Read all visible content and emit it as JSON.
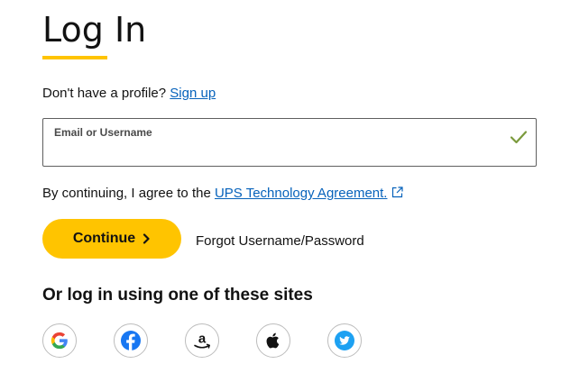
{
  "page": {
    "title": "Log In"
  },
  "signup": {
    "prompt": "Don't have a profile?",
    "link_label": "Sign up"
  },
  "email_field": {
    "label": "Email or Username",
    "value": "",
    "status_icon": "check-icon"
  },
  "agreement": {
    "prefix": "By continuing, I agree to the",
    "link_label": "UPS Technology Agreement.",
    "link_icon": "external-link-icon"
  },
  "actions": {
    "continue_label": "Continue",
    "continue_icon": "chevron-right-icon",
    "forgot_label": "Forgot Username/Password"
  },
  "social": {
    "heading": "Or log in using one of these sites",
    "providers": [
      {
        "name": "Google",
        "icon": "google-icon"
      },
      {
        "name": "Facebook",
        "icon": "facebook-icon"
      },
      {
        "name": "Amazon",
        "icon": "amazon-icon"
      },
      {
        "name": "Apple",
        "icon": "apple-icon"
      },
      {
        "name": "Twitter",
        "icon": "twitter-icon"
      }
    ]
  },
  "colors": {
    "accent": "#ffc400",
    "link": "#0662bb",
    "check": "#7b9a3c",
    "text": "#121212"
  }
}
